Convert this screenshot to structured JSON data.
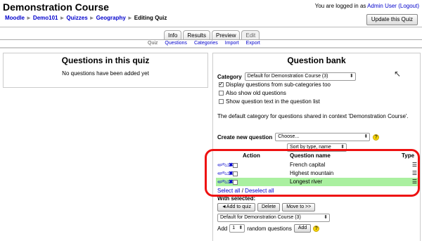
{
  "header": {
    "site_title": "Demonstration Course",
    "login_prefix": "You are logged in as",
    "user": "Admin User",
    "logout": "(Logout)",
    "update_button": "Update this Quiz"
  },
  "breadcrumb": [
    "Moodle",
    "Demo101",
    "Quizzes",
    "Geography",
    "Editing Quiz"
  ],
  "tabs": [
    {
      "label": "Info"
    },
    {
      "label": "Results"
    },
    {
      "label": "Preview"
    },
    {
      "label": "Edit"
    }
  ],
  "subtabs": [
    {
      "label": "Quiz"
    },
    {
      "label": "Questions"
    },
    {
      "label": "Categories"
    },
    {
      "label": "Import"
    },
    {
      "label": "Export"
    }
  ],
  "left": {
    "title": "Questions in this quiz",
    "empty": "No questions have been added yet"
  },
  "bank": {
    "title": "Question bank",
    "category_label": "Category",
    "category_value": "Default for Demonstration Course (3)",
    "options": [
      {
        "label": "Display questions from sub-categories too",
        "checked": true
      },
      {
        "label": "Also show old questions",
        "checked": false
      },
      {
        "label": "Show question text in the question list",
        "checked": false
      }
    ],
    "description": "The default category for questions shared in context 'Demonstration Course'.",
    "create_label": "Create new question",
    "create_value": "Choose...",
    "help_glyph": "?",
    "sort_value": "Sort by type, name",
    "col_action": "Action",
    "col_name": "Question name",
    "col_type": "Type",
    "action_icons": "«⌕✎↕✖",
    "type_icon": "☰",
    "questions": [
      {
        "name": "French capital"
      },
      {
        "name": "Highest mountain"
      },
      {
        "name": "Longest river"
      }
    ],
    "select_all": "Select all",
    "slash": "/",
    "deselect_all": "Deselect all",
    "with_selected": "With selected:",
    "add_to_quiz": "◄Add to quiz",
    "delete": "Delete",
    "move_to": "Move to >>",
    "move_category": "Default for Demonstration Course (3)",
    "add_label": "Add",
    "random_count": "1",
    "random_label": "random questions",
    "add_button": "Add"
  },
  "colors": {
    "link": "#0000cc",
    "highlight_row": "#aaf0a0",
    "annotation": "#ee1111"
  }
}
